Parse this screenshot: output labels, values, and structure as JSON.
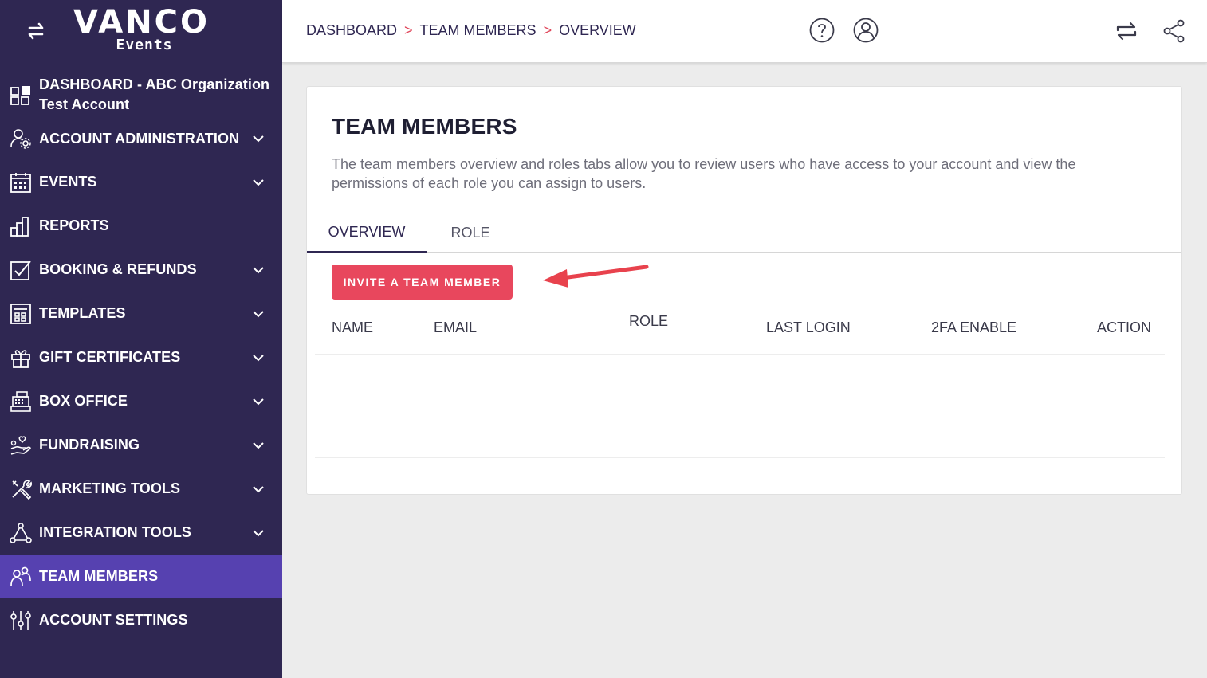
{
  "brand": {
    "name": "VANCO",
    "sub": "Events"
  },
  "sidebar": {
    "dashboard_label": "DASHBOARD - ABC Organization Test Account",
    "items": [
      {
        "label": "ACCOUNT ADMINISTRATION",
        "icon": "account-admin-icon"
      },
      {
        "label": "EVENTS",
        "icon": "calendar-icon"
      },
      {
        "label": "REPORTS",
        "icon": "bar-chart-icon"
      },
      {
        "label": "BOOKING & REFUNDS",
        "icon": "checkbox-icon"
      },
      {
        "label": "TEMPLATES",
        "icon": "template-icon"
      },
      {
        "label": "GIFT CERTIFICATES",
        "icon": "gift-icon"
      },
      {
        "label": "BOX OFFICE",
        "icon": "cash-register-icon"
      },
      {
        "label": "FUNDRAISING",
        "icon": "hand-heart-icon"
      },
      {
        "label": "MARKETING TOOLS",
        "icon": "tools-icon"
      },
      {
        "label": "INTEGRATION TOOLS",
        "icon": "integration-icon"
      },
      {
        "label": "TEAM MEMBERS",
        "icon": "team-icon"
      },
      {
        "label": "ACCOUNT SETTINGS",
        "icon": "sliders-icon"
      }
    ]
  },
  "header": {
    "breadcrumbs": [
      "DASHBOARD",
      "TEAM MEMBERS",
      "OVERVIEW"
    ],
    "separator": ">"
  },
  "main": {
    "title": "TEAM MEMBERS",
    "description": "The team members overview and roles tabs allow you to review users who have access to your account and view the permissions of each role you can assign to users.",
    "tabs": [
      {
        "label": "OVERVIEW",
        "active": true
      },
      {
        "label": "ROLE",
        "active": false
      }
    ],
    "invite_button": "INVITE A TEAM MEMBER",
    "table": {
      "headers": [
        "NAME",
        "EMAIL",
        "ROLE",
        "LAST LOGIN",
        "2FA ENABLE",
        "ACTION"
      ]
    }
  },
  "colors": {
    "sidebar_bg": "#2f2752",
    "sidebar_active": "#5641b0",
    "accent_red": "#e8475d",
    "page_bg": "#ececec"
  }
}
